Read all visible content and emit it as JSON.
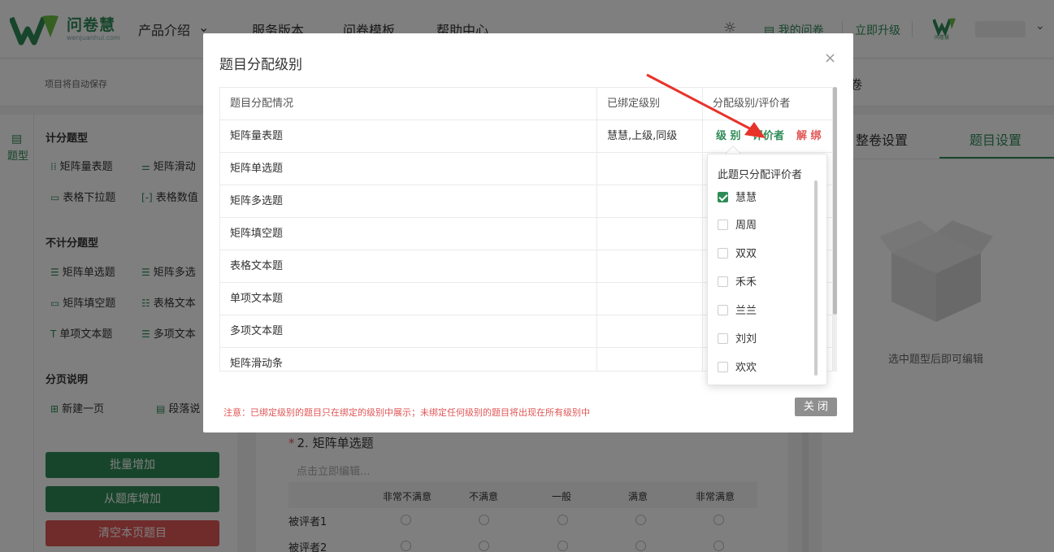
{
  "header": {
    "logo_text": "问卷慧",
    "logo_sub": "wenjuanhui.com",
    "nav": [
      "产品介绍",
      "服务版本",
      "问卷模板",
      "帮助中心"
    ],
    "my_survey": "我的问卷",
    "upgrade": "立即升级",
    "avatar_text": "问卷慧"
  },
  "subbar": {
    "autosave": "项目将自动保存",
    "right_text": "卷"
  },
  "left_rail": {
    "label": "题型"
  },
  "left_panel": {
    "section_scored": "计分题型",
    "scored_items": [
      "矩阵量表题",
      "矩阵滑动",
      "表格下拉题",
      "表格数值"
    ],
    "section_unscored": "不计分题型",
    "unscored_items": [
      "矩阵单选题",
      "矩阵多选",
      "矩阵填空题",
      "表格文本",
      "单项文本题",
      "多项文本"
    ],
    "section_page": "分页说明",
    "page_items": [
      "新建一页",
      "段落说"
    ],
    "btn_batch": "批量增加",
    "btn_bank": "从题库增加",
    "btn_clear": "清空本页题目"
  },
  "center": {
    "question_no": "2.",
    "question_title": "矩阵单选题",
    "hint": "点击立即编辑...",
    "columns": [
      "非常不满意",
      "不满意",
      "一般",
      "满意",
      "非常满意"
    ],
    "rows": [
      "被评者1",
      "被评者2"
    ]
  },
  "right_panel": {
    "tab_survey": "整卷设置",
    "tab_question": "题目设置",
    "hint": "选中题型后即可编辑"
  },
  "modal": {
    "title": "题目分配级别",
    "close_icon": "×",
    "headers": [
      "题目分配情况",
      "已绑定级别",
      "分配级别/评价者"
    ],
    "rows": [
      {
        "name": "矩阵量表题",
        "bound": "慧慧,上级,同级"
      },
      {
        "name": "矩阵单选题",
        "bound": ""
      },
      {
        "name": "矩阵多选题",
        "bound": ""
      },
      {
        "name": "矩阵填空题",
        "bound": ""
      },
      {
        "name": "表格文本题",
        "bound": ""
      },
      {
        "name": "单项文本题",
        "bound": ""
      },
      {
        "name": "多项文本题",
        "bound": ""
      },
      {
        "name": "矩阵滑动条",
        "bound": ""
      }
    ],
    "actions": {
      "level": "级 别",
      "evaluator": "评价者",
      "unbind": "解 绑"
    },
    "note": "注意：已绑定级别的题目只在绑定的级别中展示；未绑定任何级别的题目将出现在所有级别中",
    "close_button": "关 闭"
  },
  "popover": {
    "title": "此题只分配评价者",
    "options": [
      {
        "label": "慧慧",
        "checked": true
      },
      {
        "label": "周周",
        "checked": false
      },
      {
        "label": "双双",
        "checked": false
      },
      {
        "label": "禾禾",
        "checked": false
      },
      {
        "label": "兰兰",
        "checked": false
      },
      {
        "label": "刘刘",
        "checked": false
      },
      {
        "label": "欢欢",
        "checked": false
      }
    ]
  },
  "colors": {
    "brand_green": "#2e8b57",
    "danger_red": "#e05656",
    "annotation_red": "#e8332a"
  }
}
